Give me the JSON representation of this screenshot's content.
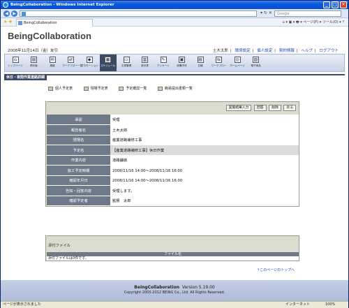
{
  "window": {
    "title": "BeingCollaboration - Windows Internet Explorer",
    "minimize": "_",
    "maximize": "□",
    "close": "✕"
  },
  "browser": {
    "back": "◀",
    "forward": "▶",
    "address": "",
    "search_placeholder": "Google",
    "tab_label": "BeingCollaboration",
    "addr_icons": "▾ ↻ ✕",
    "favorites_icons": "★ ✚",
    "commands": "⌂ ▾  ▣ ▾  🖶 ▾  ページ(P) ▾  ツール(O) ▾  ?"
  },
  "app": {
    "title": "BeingCollaboration",
    "date": "2008年11月14日（金）友引",
    "user": "土木太郎",
    "links": [
      "環境設定",
      "個人設定",
      "契約情報",
      "ヘルプ",
      "ログアウト"
    ]
  },
  "toolbar": {
    "items": [
      {
        "label": "トップページ",
        "icon": "home-icon",
        "glyph": "⌂"
      },
      {
        "label": "掲示板",
        "icon": "board-icon",
        "glyph": "▤"
      },
      {
        "label": "連絡",
        "icon": "mail-icon",
        "glyph": "✉"
      },
      {
        "label": "ワークフロー一覧",
        "icon": "flow-icon",
        "glyph": "⇄"
      },
      {
        "label": "プロモーション",
        "icon": "promo-icon",
        "glyph": "◆"
      },
      {
        "label": "スケジュール",
        "icon": "calendar-icon",
        "glyph": "▦",
        "active": true
      },
      {
        "label": "文書管理",
        "icon": "folder-icon",
        "glyph": "▭"
      },
      {
        "label": "設計書",
        "icon": "document-icon",
        "glyph": "▥"
      },
      {
        "label": "アンケート",
        "icon": "survey-icon",
        "glyph": "✎"
      },
      {
        "label": "設備予約",
        "icon": "facility-icon",
        "glyph": "▣"
      },
      {
        "label": "日報",
        "icon": "report-icon",
        "glyph": "▤"
      },
      {
        "label": "ワークフロー",
        "icon": "workflow-icon",
        "glyph": "⇆"
      },
      {
        "label": "ホームページ",
        "icon": "web-icon",
        "glyph": "◎"
      },
      {
        "label": "電子納品",
        "icon": "delivery-icon",
        "glyph": "▧"
      }
    ]
  },
  "section": {
    "title": "休日・夜間作業連絡詳細"
  },
  "sublinks": [
    {
      "label": "個人予定表",
      "icon": "person-icon"
    },
    {
      "label": "現場予定表",
      "icon": "site-icon"
    },
    {
      "label": "予定確認一覧",
      "icon": "list-icon"
    },
    {
      "label": "簡易提出書類一覧",
      "icon": "docs-icon"
    }
  ],
  "actions": [
    "実施結果入力",
    "回答",
    "削除",
    "戻る"
  ],
  "details": [
    {
      "key": "承認",
      "value": "受理"
    },
    {
      "key": "報告者名",
      "value": "土木太郎"
    },
    {
      "key": "現場名",
      "value": "産業道路補修工事"
    },
    {
      "key": "予定名",
      "value": "【産業道路補修工事】休日作業"
    },
    {
      "key": "作業内容",
      "value": "道路舗装"
    },
    {
      "key": "施工予定時期",
      "value": "2008/11/16 14:00～2008/11/16 16:00"
    },
    {
      "key": "確認年月日",
      "value": "2008/11/16 14:00～2008/11/16 16:00"
    },
    {
      "key": "告知・回答内容",
      "value": "受理します。"
    },
    {
      "key": "確認予定者",
      "value": "監督　太郎"
    }
  ],
  "attachments": {
    "title": "添付ファイル",
    "column": "ファイル名",
    "empty": "添付ファイルは0件です。"
  },
  "totop": "このページのトップへ",
  "footer": {
    "product": "BeingCollaboration",
    "version": "Version 5.19.00",
    "copyright": "Copyright 2005-2012 BEING Co., Ltd. All Rights Reserved."
  },
  "status": {
    "text": "ページが表示されました",
    "zone": "インターネット",
    "zoom": "100%"
  }
}
